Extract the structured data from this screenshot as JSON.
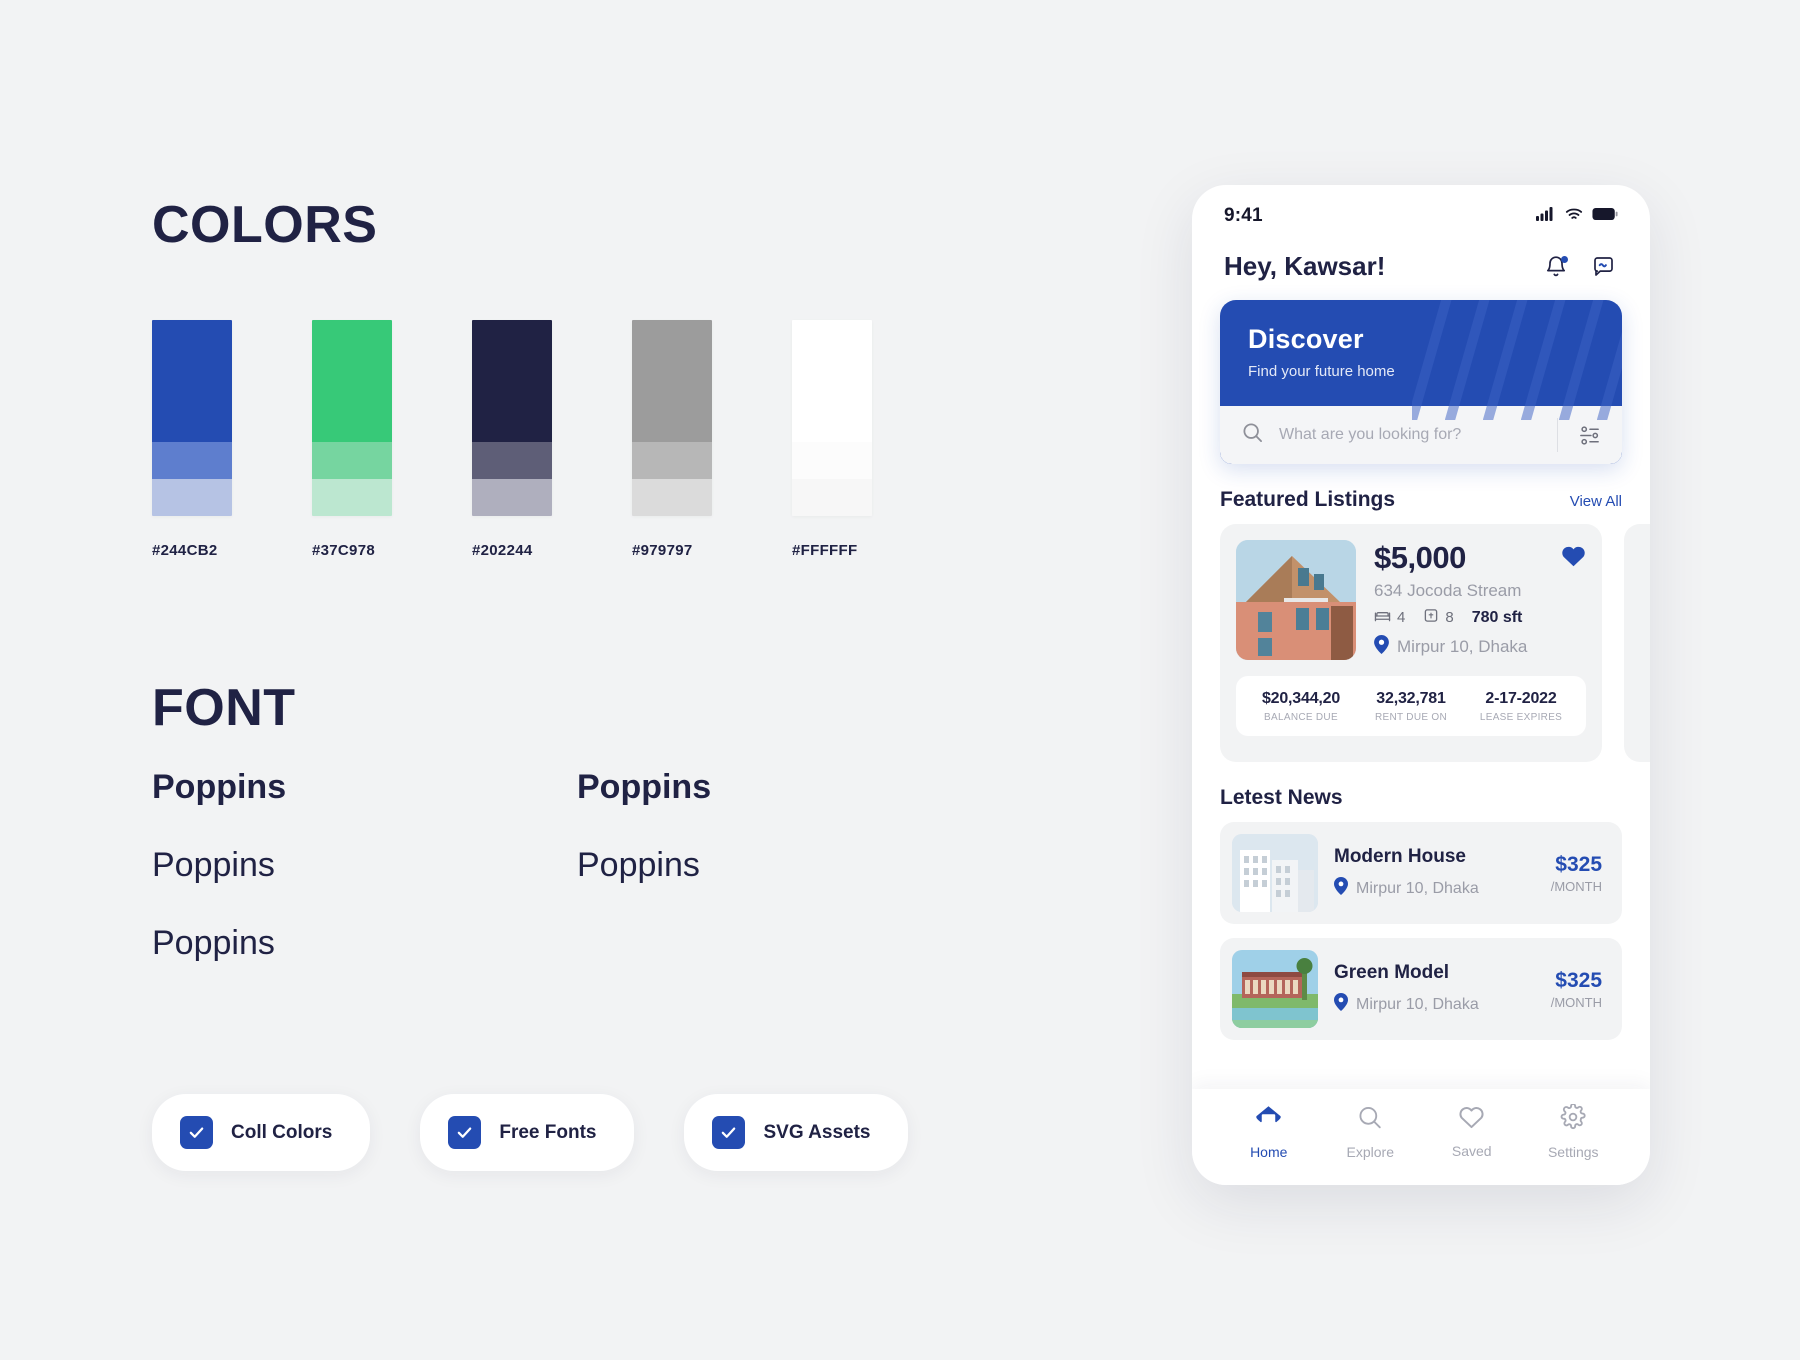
{
  "styleguide": {
    "colors_title": "COLORS",
    "font_title": "FONT",
    "swatches": [
      {
        "name": "primary-blue",
        "hex": "#244CB2",
        "tiers": [
          "#244CB2",
          "#5E7ECE",
          "#B6C3E4"
        ]
      },
      {
        "name": "accent-green",
        "hex": "#37C978",
        "tiers": [
          "#37C978",
          "#76D5A0",
          "#BCE7D0"
        ]
      },
      {
        "name": "dark-navy",
        "hex": "#202244",
        "tiers": [
          "#202244",
          "#5E5E77",
          "#AFAFBE"
        ]
      },
      {
        "name": "neutral-gray",
        "hex": "#979797",
        "tiers": [
          "#9C9C9C",
          "#B7B7B7",
          "#DBDBDB"
        ]
      },
      {
        "name": "white",
        "hex": "#FFFFFF",
        "tiers": [
          "#FFFFFF",
          "#FCFCFC",
          "#F7F7F7"
        ]
      }
    ],
    "font_samples": {
      "left": [
        "Poppins",
        "Poppins",
        "Poppins"
      ],
      "right": [
        "Poppins",
        "Poppins"
      ]
    },
    "pills": [
      {
        "label": "Coll Colors"
      },
      {
        "label": "Free Fonts"
      },
      {
        "label": "SVG Assets"
      }
    ]
  },
  "phone": {
    "statusbar": {
      "time": "9:41",
      "icons": [
        "cellular-signal-icon",
        "wifi-icon",
        "battery-icon"
      ]
    },
    "header": {
      "greeting": "Hey, Kawsar!",
      "icons": [
        "bell-icon",
        "chat-icon"
      ]
    },
    "discover": {
      "title": "Discover",
      "subtitle": "Find your future home",
      "search_placeholder": "What are you looking for?",
      "search_value": "",
      "search_icon": "search-icon",
      "filter_icon": "filter-sliders-icon"
    },
    "featured": {
      "section_title": "Featured Listings",
      "view_all": "View All",
      "card": {
        "price": "$5,000",
        "address": "634 Jocoda Stream",
        "beds": "4",
        "baths": "8",
        "area": "780 sft",
        "location": "Mirpur 10, Dhaka",
        "favorite_icon": "heart-filled-icon",
        "bed_icon": "bed-icon",
        "bath_icon": "bath-icon",
        "pin_icon": "location-pin-icon",
        "stats": [
          {
            "value": "$20,344,20",
            "label": "BALANCE DUE"
          },
          {
            "value": "32,32,781",
            "label": "RENT DUE ON"
          },
          {
            "value": "2-17-2022",
            "label": "LEASE EXPIRES"
          }
        ]
      }
    },
    "news": {
      "section_title": "Letest News",
      "items": [
        {
          "title": "Modern House",
          "location": "Mirpur 10, Dhaka",
          "price": "$325",
          "period": "/MONTH"
        },
        {
          "title": "Green Model",
          "location": "Mirpur 10, Dhaka",
          "price": "$325",
          "period": "/MONTH"
        }
      ]
    },
    "tabbar": {
      "items": [
        {
          "label": "Home",
          "icon": "home-icon",
          "active": true
        },
        {
          "label": "Explore",
          "icon": "search-icon",
          "active": false
        },
        {
          "label": "Saved",
          "icon": "heart-icon",
          "active": false
        },
        {
          "label": "Settings",
          "icon": "gear-icon",
          "active": false
        }
      ]
    }
  },
  "theme": {
    "background": "#F2F3F4",
    "primary": "#244CB2",
    "accent": "#37C978",
    "dark": "#202244",
    "muted": "#979797",
    "surface": "#FFFFFF"
  }
}
